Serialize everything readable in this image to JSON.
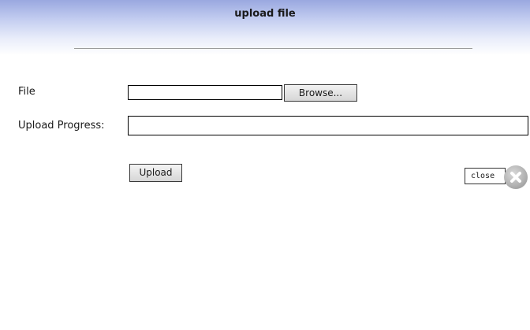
{
  "dialog": {
    "title": "upload file"
  },
  "form": {
    "file_label": "File",
    "file_value": "",
    "browse_label": "Browse...",
    "progress_label": "Upload Progress:",
    "progress_percent": 0,
    "upload_label": "Upload"
  },
  "close": {
    "label": "close",
    "icon": "close-x-circle-icon"
  },
  "colors": {
    "header_top": "#9aa8e0",
    "header_bottom": "#ffffff"
  }
}
